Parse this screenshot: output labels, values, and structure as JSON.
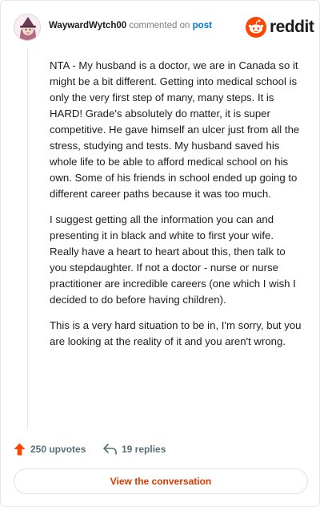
{
  "header": {
    "username": "WaywardWytch00",
    "action_text": "commented on",
    "post_link": "post",
    "brand": "reddit"
  },
  "colors": {
    "brand_orange": "#ff4500",
    "link_blue": "#0079d3",
    "action_red": "#d93a00",
    "muted_text": "#576f76"
  },
  "comment": {
    "paragraphs": [
      "NTA - My husband is a doctor, we are in Canada so it might be a bit different. Getting into medical school is only the very first step of many, many steps. It is HARD! Grade's absolutely do matter, it is super competitive. He gave himself an ulcer just from all the stress, studying and tests. My husband saved his whole life to be able to afford medical school on his own. Some of his friends in school ended up going to different career paths because it was too much.",
      "I suggest getting all the information you can and presenting it in black and white to first your wife. Really have a heart to heart about this, then talk to you stepdaughter. If not a doctor - nurse or nurse practitioner are incredible careers (one which I wish I decided to do before having children).",
      "This is a very hard situation to be in, I'm sorry, but you are looking at the reality of it and you aren't wrong."
    ]
  },
  "footer": {
    "upvotes": "250 upvotes",
    "replies": "19 replies",
    "view_conversation": "View the conversation"
  },
  "icons": {
    "upvote": "upvote-arrow-icon",
    "reply": "reply-arrow-icon",
    "logo": "reddit-snoo-icon",
    "avatar": "user-avatar"
  }
}
